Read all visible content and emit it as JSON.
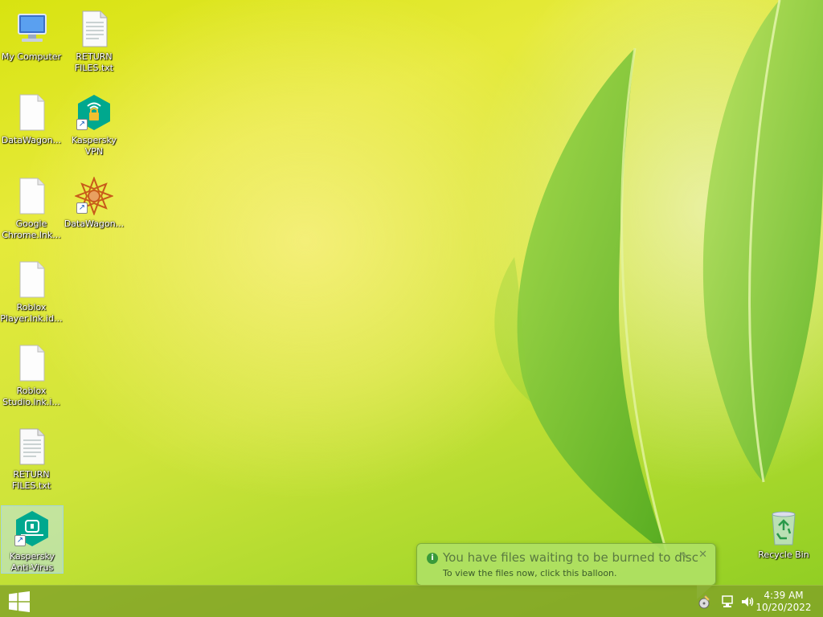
{
  "desktop": {
    "icons": [
      {
        "label": "My Computer",
        "icon": "computer-icon"
      },
      {
        "label": "RETURN FILES.txt",
        "icon": "text-file-icon"
      },
      {
        "label": "DataWagon...",
        "icon": "blank-file-icon"
      },
      {
        "label": "Kaspersky VPN",
        "icon": "kaspersky-vpn-icon"
      },
      {
        "label": "Google Chrome.lnk...",
        "icon": "blank-file-icon"
      },
      {
        "label": "DataWagon...",
        "icon": "datawagon-icon"
      },
      {
        "label": "Roblox Player.lnk.id...",
        "icon": "blank-file-icon"
      },
      {
        "label": "Roblox Studio.lnk.i...",
        "icon": "blank-file-icon"
      },
      {
        "label": "RETURN FILES.txt",
        "icon": "text-file-icon"
      },
      {
        "label": "Kaspersky Anti-Virus",
        "icon": "kaspersky-antivirus-icon"
      },
      {
        "label": "Recycle Bin",
        "icon": "recycle-bin-icon"
      }
    ]
  },
  "balloon": {
    "title": "You have files waiting to be burned to disc",
    "body": "To view the files now, click this balloon.",
    "options_glyph": "✎",
    "close_glyph": "✕"
  },
  "taskbar": {
    "time": "4:39 AM",
    "date": "10/20/2022"
  },
  "colors": {
    "taskbar": "#80a028",
    "balloon": "#afe164",
    "kaspersky": "#00a88e"
  }
}
